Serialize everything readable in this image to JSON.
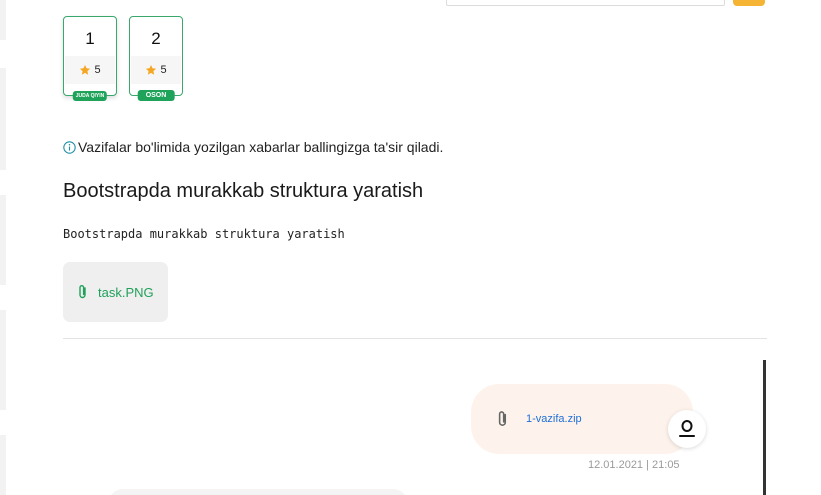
{
  "tasks": [
    {
      "number": "1",
      "score": "5",
      "difficulty": "JUDA QIYIN"
    },
    {
      "number": "2",
      "score": "5",
      "difficulty": "OSON"
    }
  ],
  "info": {
    "text": "Vazifalar bo'limida yozilgan xabarlar ballingizga ta'sir qiladi."
  },
  "task": {
    "title": "Bootstrapda murakkab struktura yaratish",
    "description": "Bootstrapda murakkab struktura yaratish",
    "attachment": "task.PNG"
  },
  "chat": {
    "message_file": "1-vazifa.zip",
    "message_time": "12.01.2021 | 21:05"
  },
  "colors": {
    "accent_green": "#1fa35b",
    "star": "#f5a623",
    "link_blue": "#1f6fd6",
    "bubble_bg": "#fdf3ec",
    "search_button": "#f5b433"
  }
}
